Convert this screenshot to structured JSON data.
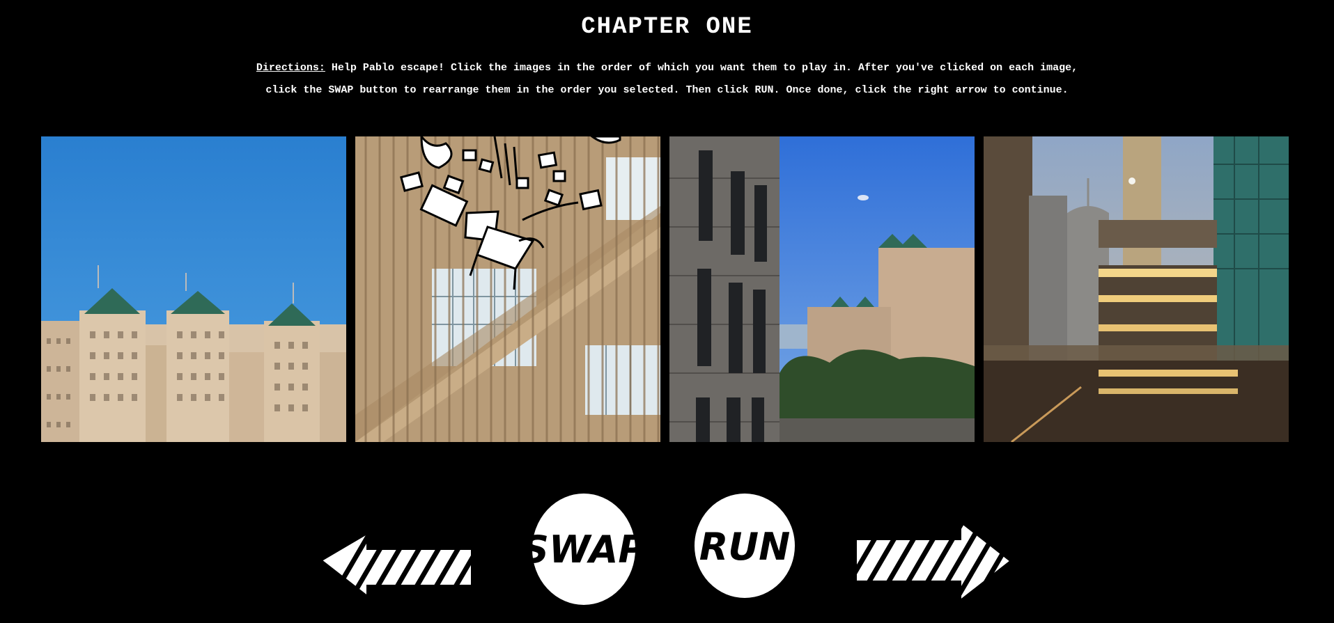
{
  "header": {
    "title": "CHAPTER ONE"
  },
  "directions": {
    "label": "Directions:",
    "line1": " Help Pablo escape! Click the images in the order of which you want them to play in. After you've clicked on each image,",
    "line2": "click the SWAP button to rearrange them in the order you selected. Then click RUN. Once done, click the right arrow to continue."
  },
  "gallery": {
    "images": [
      {
        "subject": "apartment towers against blue sky"
      },
      {
        "subject": "stairwell with falling chair drawing"
      },
      {
        "subject": "office building and apartment towers"
      },
      {
        "subject": "city skyline at dusk through window"
      }
    ]
  },
  "controls": {
    "swap_label": "SWAP",
    "run_label": "RUN",
    "left_arrow_icon": "hatched-left-arrow-icon",
    "right_arrow_icon": "hatched-right-arrow-icon"
  },
  "colors": {
    "background": "#000000",
    "sky_blue": "#2f86d4",
    "ink": "#ffffff"
  }
}
